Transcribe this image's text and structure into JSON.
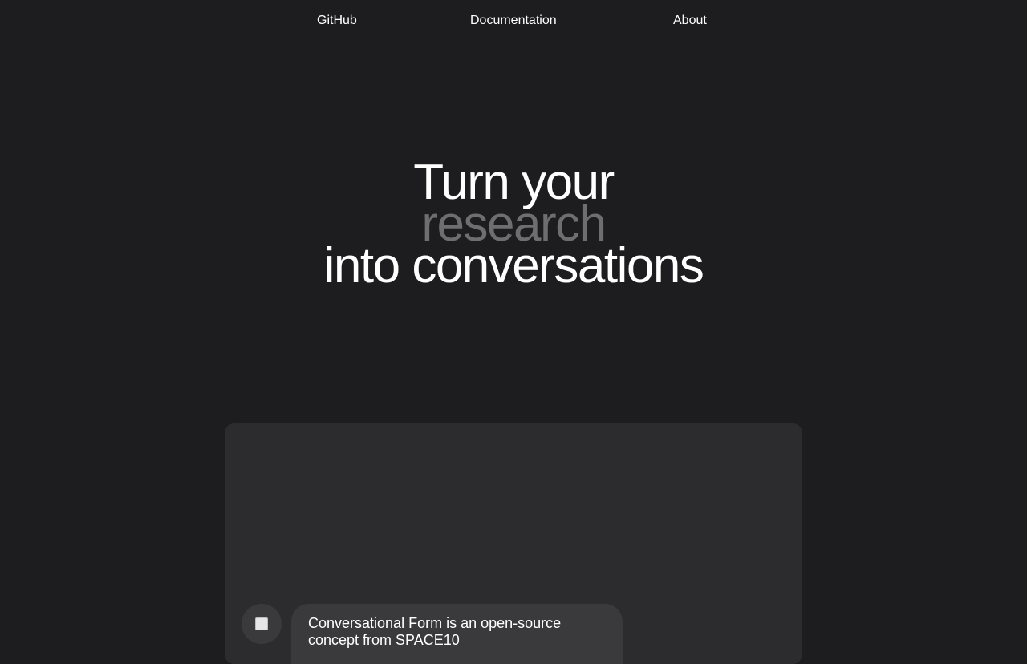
{
  "nav": {
    "items": [
      {
        "label": "GitHub"
      },
      {
        "label": "Documentation"
      },
      {
        "label": "About"
      }
    ]
  },
  "hero": {
    "line1": "Turn your",
    "line2": "research",
    "line3": "into conversations"
  },
  "chat": {
    "bot_icon": "robot-avatar-icon",
    "message": "Conversational Form is an open-source concept from SPACE10"
  },
  "colors": {
    "background": "#1d1d1f",
    "panel": "#2c2c2e",
    "bubble": "#3a3a3c",
    "highlight_word": "#6e6e71"
  }
}
